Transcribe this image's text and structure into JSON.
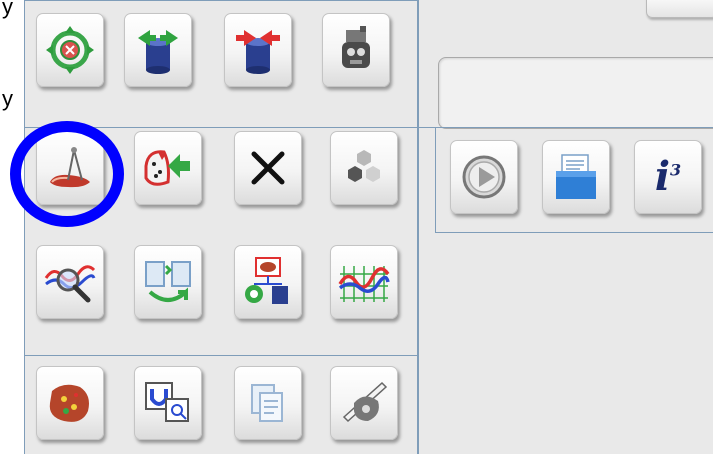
{
  "edge_text": {
    "top_left_letter": "y",
    "mid_left_letter": "y"
  },
  "tool_groups": [
    {
      "name": "group-1",
      "tools": [
        "target-move-icon",
        "cylinder-export-icon",
        "cylinder-import-icon",
        "robot-head-icon"
      ]
    },
    {
      "name": "group-2",
      "tools": [
        "measure-foot-icon",
        "scatter-arrow-icon",
        "delete-x-icon",
        "hexagon-cluster-icon",
        "search-wave-icon",
        "sync-documents-icon",
        "model-transfer-icon",
        "signal-grid-icon"
      ]
    },
    {
      "name": "group-3",
      "tools": [
        "surface-map-icon",
        "scan-magnify-icon",
        "documents-icon",
        "sketch-tools-icon"
      ]
    }
  ],
  "right_panel": {
    "buttons": [
      "play-icon",
      "file-box-icon",
      "info-icon"
    ],
    "info_label": "i",
    "info_superscript": "3"
  },
  "highlight": {
    "color": "#0000ff",
    "target": "measure-foot-icon"
  },
  "colors": {
    "panel_bg": "#e9e9e9",
    "divider": "#7f9db9"
  }
}
